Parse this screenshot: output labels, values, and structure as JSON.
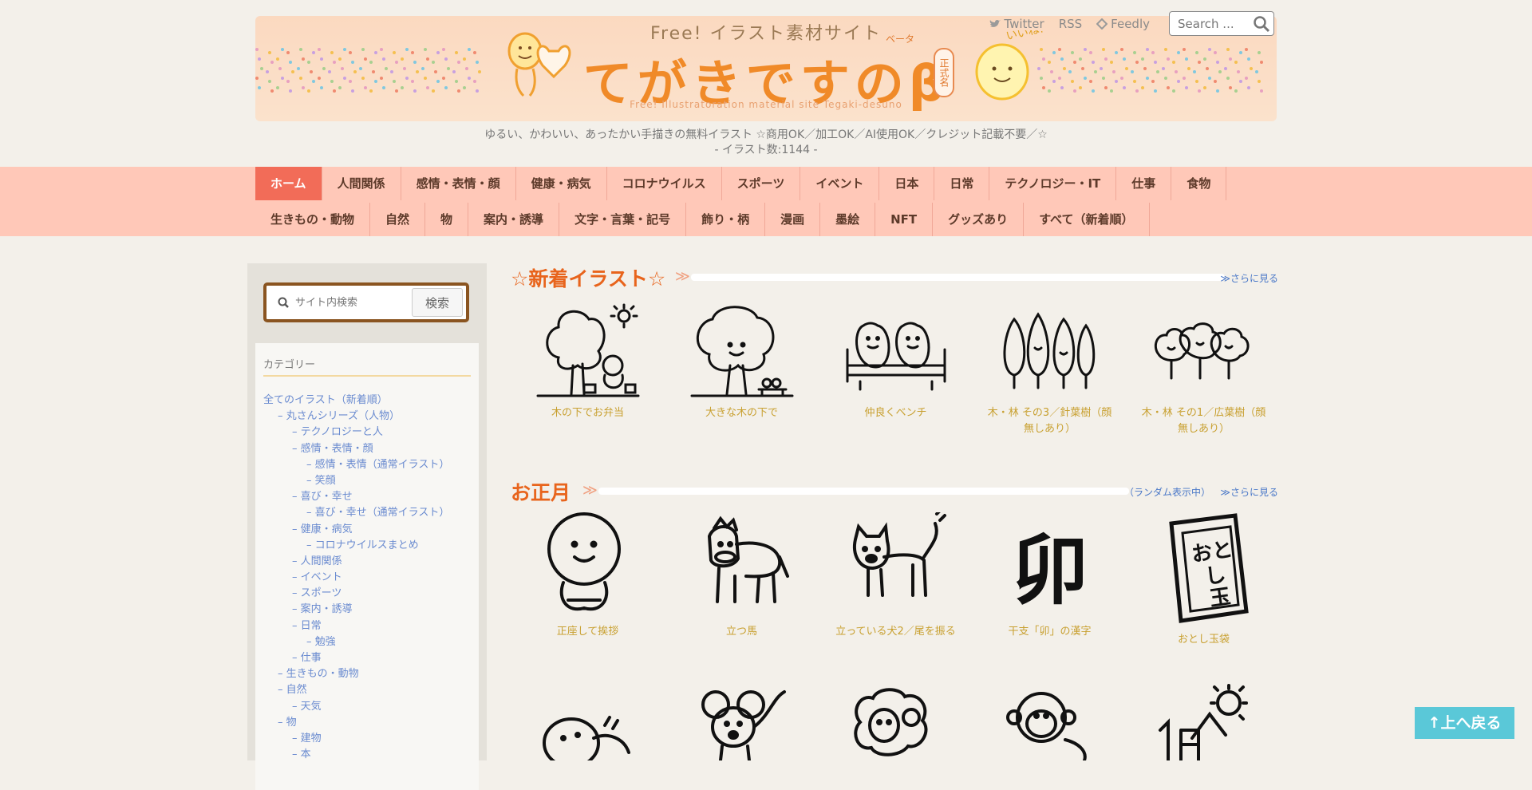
{
  "header": {
    "free_title": "Free! イラスト素材サイト",
    "logo": "てがきですのβ",
    "beta_kana": "ベータ",
    "official": "正式名",
    "subtitle_en": "Free! Illustratoration material site Tegaki-desuno",
    "links": {
      "twitter": "Twitter",
      "rss": "RSS",
      "feedly": "Feedly"
    },
    "search_placeholder": "Search ..."
  },
  "tagline": {
    "line1": "ゆるい、かわいい、あったかい手描きの無料イラスト ☆商用OK／加工OK／AI使用OK／クレジット記載不要／☆",
    "line2": "- イラスト数:1144 -"
  },
  "nav": {
    "row1": [
      "ホーム",
      "人間関係",
      "感情・表情・顔",
      "健康・病気",
      "コロナウイルス",
      "スポーツ",
      "イベント",
      "日本",
      "日常",
      "テクノロジー・IT",
      "仕事",
      "食物"
    ],
    "row2": [
      "生きもの・動物",
      "自然",
      "物",
      "案内・誘導",
      "文字・言葉・記号",
      "飾り・柄",
      "漫画",
      "墨絵",
      "NFT",
      "グッズあり",
      "すべて（新着順）"
    ]
  },
  "sidebar": {
    "search_placeholder": "サイト内検索",
    "search_button": "検索",
    "category_title": "カテゴリー",
    "categories": [
      {
        "label": "全てのイラスト（新着順）",
        "level": 0
      },
      {
        "label": "– 丸さんシリーズ（人物）",
        "level": 1
      },
      {
        "label": "– テクノロジーと人",
        "level": 2
      },
      {
        "label": "– 感情・表情・顔",
        "level": 2
      },
      {
        "label": "– 感情・表情（通常イラスト）",
        "level": 3
      },
      {
        "label": "– 笑顔",
        "level": 3
      },
      {
        "label": "– 喜び・幸せ",
        "level": 2
      },
      {
        "label": "– 喜び・幸せ（通常イラスト）",
        "level": 3
      },
      {
        "label": "– 健康・病気",
        "level": 2
      },
      {
        "label": "– コロナウイルスまとめ",
        "level": 3
      },
      {
        "label": "– 人間関係",
        "level": 2
      },
      {
        "label": "– イベント",
        "level": 2
      },
      {
        "label": "– スポーツ",
        "level": 2
      },
      {
        "label": "– 案内・誘導",
        "level": 2
      },
      {
        "label": "– 日常",
        "level": 2
      },
      {
        "label": "– 勉強",
        "level": 3
      },
      {
        "label": "– 仕事",
        "level": 2
      },
      {
        "label": "– 生きもの・動物",
        "level": 1
      },
      {
        "label": "– 自然",
        "level": 1
      },
      {
        "label": "– 天気",
        "level": 2
      },
      {
        "label": "– 物",
        "level": 1
      },
      {
        "label": "– 建物",
        "level": 2
      },
      {
        "label": "– 本",
        "level": 2
      }
    ]
  },
  "sections": {
    "new": {
      "title": "☆新着イラスト☆",
      "more": "≫さらに見る",
      "items": [
        "木の下でお弁当",
        "大きな木の下で",
        "仲良くベンチ",
        "木・林 その3／針葉樹（顔無しあり）",
        "木・林 その1／広葉樹（顔無しあり）"
      ]
    },
    "newyear": {
      "title": "お正月",
      "random": "（ランダム表示中）",
      "more": "≫さらに見る",
      "items": [
        "正座して挨拶",
        "立つ馬",
        "立っている犬2／尾を振る",
        "干支「卯」の漢字",
        "おとし玉袋"
      ]
    }
  },
  "to_top": "↑上へ戻る"
}
